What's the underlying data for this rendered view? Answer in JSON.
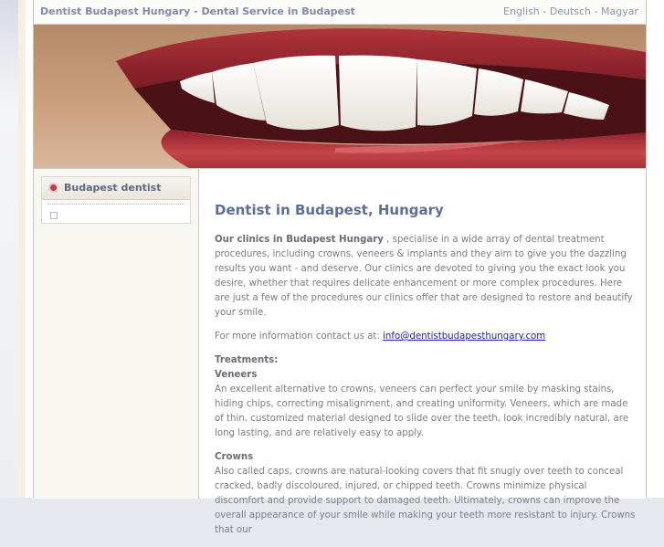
{
  "header": {
    "site_title": "Dentist Budapest Hungary - Dental Service in Budapest",
    "languages": [
      "English",
      "Deutsch",
      "Magyar"
    ],
    "separator": " - "
  },
  "sidebar": {
    "box_title": "Budapest dentist"
  },
  "content": {
    "heading": "Dentist in Budapest, Hungary",
    "intro_bold": "Our clinics in Budapest Hungary",
    "intro_text": " , specialise in a wide array of dental treatment procedures, including crowns, veneers & implants and they aim to give you the dazzling results you want - and deserve. Our clinics are devoted to giving you the exact look you desire, whether that requires delicate enhancement or more complex procedures. Here are just a few of the procedures our clinics offer that are designed to restore and beautify your smile.",
    "contact_text": "For more information contact us at: ",
    "contact_email": "info@dentistbudapesthungary.com",
    "treatments_label": "Treatments:",
    "veneers_title": "Veneers",
    "veneers_text": "An excellent alternative to crowns, veneers can perfect your smile by masking stains, hiding chips, correcting misalignment, and creating uniformity. Veneers, which are made of thin, customized material designed to slide over the teeth, look incredibly natural, are long lasting, and are relatively easy to apply.",
    "crowns_title": "Crowns",
    "crowns_text": "Also called caps, crowns are natural-looking covers that fit snugly over teeth to conceal cracked, badly discoloured, injured, or chipped teeth. Crowns minimize physical discomfort and provide support to damaged teeth. Ultimately, crowns can improve the overall appearance of your smile while making your teeth more resistant to injury. Crowns that our"
  }
}
